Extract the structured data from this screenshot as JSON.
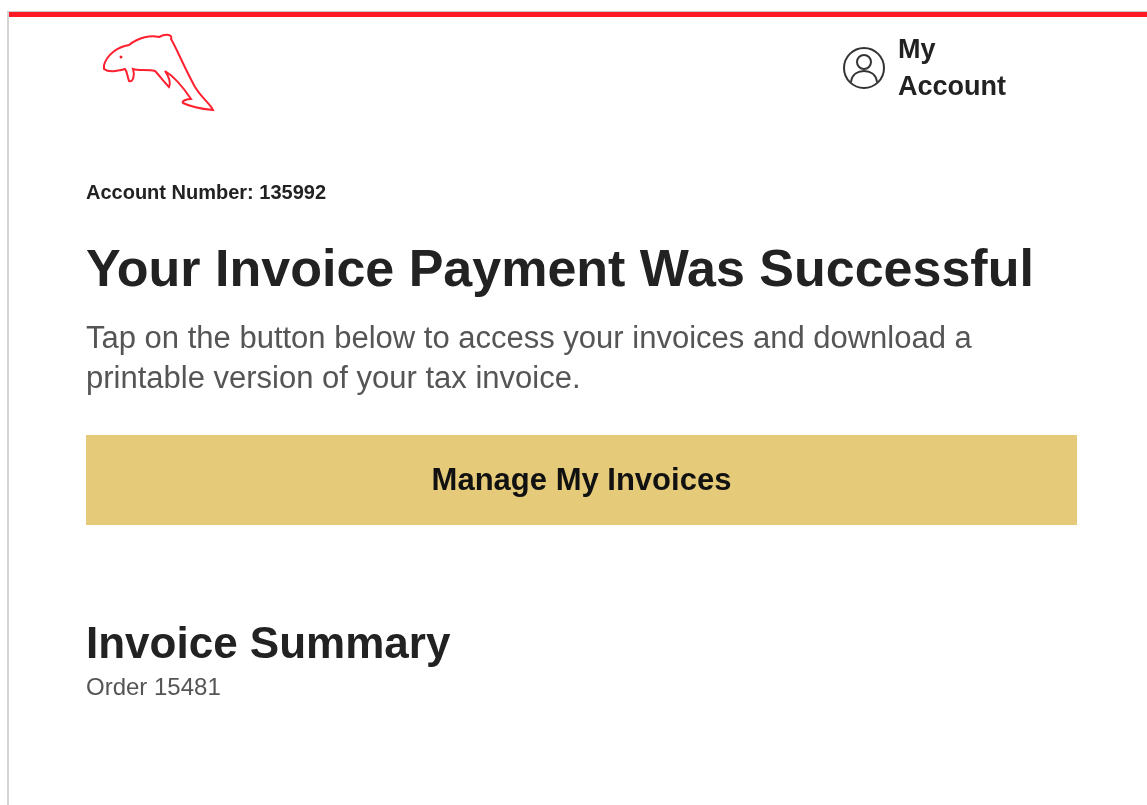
{
  "header": {
    "account_link": "My Account"
  },
  "account_number": {
    "label": "Account Number:",
    "value": "135992"
  },
  "title": "Your Invoice Payment Was Successful",
  "message": "Tap on the button below to access your invoices and download a printable version of your tax invoice.",
  "button": "Manage My Invoices",
  "summary": {
    "title": "Invoice Summary",
    "order": "Order 15481"
  }
}
